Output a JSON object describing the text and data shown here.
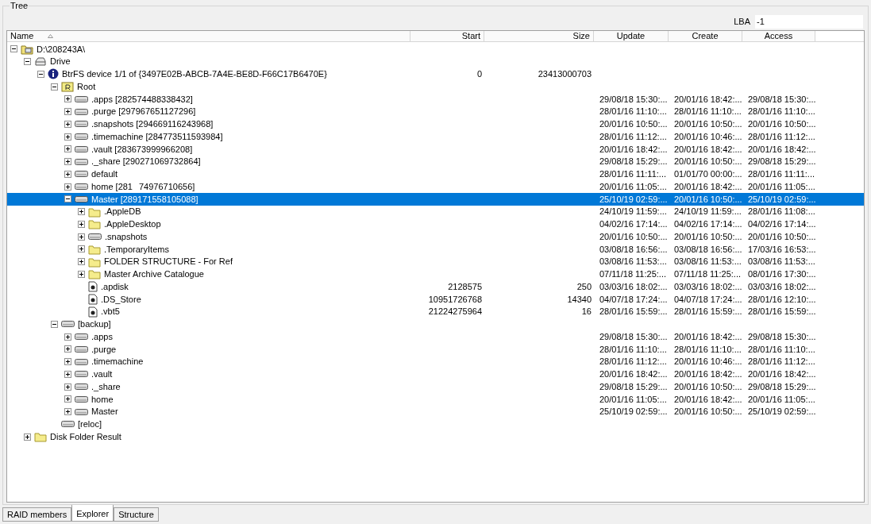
{
  "group_title": "Tree",
  "lba": {
    "label": "LBA",
    "value": "-1"
  },
  "columns": [
    {
      "label": "Name",
      "sorted": true
    },
    {
      "label": "Start",
      "sorted": false
    },
    {
      "label": "Size",
      "sorted": false
    },
    {
      "label": "Update",
      "sorted": false
    },
    {
      "label": "Create",
      "sorted": false
    },
    {
      "label": "Access",
      "sorted": false
    }
  ],
  "tree": [
    {
      "name": "D:\\208243A\\",
      "kind": "computer",
      "expanded": true,
      "selected": false,
      "children": [
        {
          "name": "Drive",
          "kind": "drive",
          "expanded": true,
          "selected": false,
          "children": [
            {
              "name": "BtrFS device 1/1 of {3497E02B-ABCB-7A4E-BE8D-F66C17B6470E}",
              "kind": "info",
              "expanded": true,
              "selected": false,
              "start": "0",
              "size": "23413000703",
              "children": [
                {
                  "name": "Root",
                  "kind": "root",
                  "expanded": true,
                  "selected": false,
                  "children": [
                    {
                      "name": ".apps [282574488338432]",
                      "kind": "disk",
                      "expanded": false,
                      "selected": false,
                      "update": "29/08/18 15:30:...",
                      "create": "20/01/16 18:42:...",
                      "access": "29/08/18 15:30:..."
                    },
                    {
                      "name": ".purge [297967651127296]",
                      "kind": "disk",
                      "expanded": false,
                      "selected": false,
                      "update": "28/01/16 11:10:...",
                      "create": "28/01/16 11:10:...",
                      "access": "28/01/16 11:10:..."
                    },
                    {
                      "name": ".snapshots [294669116243968]",
                      "kind": "disk",
                      "expanded": false,
                      "selected": false,
                      "update": "20/01/16 10:50:...",
                      "create": "20/01/16 10:50:...",
                      "access": "20/01/16 10:50:..."
                    },
                    {
                      "name": ".timemachine [284773511593984]",
                      "kind": "disk",
                      "expanded": false,
                      "selected": false,
                      "update": "28/01/16 11:12:...",
                      "create": "20/01/16 10:46:...",
                      "access": "28/01/16 11:12:..."
                    },
                    {
                      "name": ".vault [283673999966208]",
                      "kind": "disk",
                      "expanded": false,
                      "selected": false,
                      "update": "20/01/16 18:42:...",
                      "create": "20/01/16 18:42:...",
                      "access": "20/01/16 18:42:..."
                    },
                    {
                      "name": "._share [290271069732864]",
                      "kind": "disk",
                      "expanded": false,
                      "selected": false,
                      "update": "29/08/18 15:29:...",
                      "create": "20/01/16 10:50:...",
                      "access": "29/08/18 15:29:..."
                    },
                    {
                      "name": "default",
                      "kind": "disk",
                      "expanded": false,
                      "selected": false,
                      "update": "28/01/16 11:11:...",
                      "create": "01/01/70 00:00:...",
                      "access": "28/01/16 11:11:..."
                    },
                    {
                      "name": "home [281",
                      "name_tail": "74976710656]",
                      "kind": "disk",
                      "expanded": false,
                      "selected": false,
                      "update": "20/01/16 11:05:...",
                      "create": "20/01/16 18:42:...",
                      "access": "20/01/16 11:05:..."
                    },
                    {
                      "name": "Master [289171558105088]",
                      "kind": "disk",
                      "expanded": true,
                      "selected": true,
                      "update": "25/10/19 02:59:...",
                      "create": "20/01/16 10:50:...",
                      "access": "25/10/19 02:59:...",
                      "children": [
                        {
                          "name": ".AppleDB",
                          "kind": "folder",
                          "expanded": false,
                          "selected": false,
                          "update": "24/10/19 11:59:...",
                          "create": "24/10/19 11:59:...",
                          "access": "28/01/16 11:08:..."
                        },
                        {
                          "name": ".AppleDesktop",
                          "kind": "folder",
                          "expanded": false,
                          "selected": false,
                          "update": "04/02/16 17:14:...",
                          "create": "04/02/16 17:14:...",
                          "access": "04/02/16 17:14:..."
                        },
                        {
                          "name": ".snapshots",
                          "kind": "disk",
                          "expanded": false,
                          "selected": false,
                          "update": "20/01/16 10:50:...",
                          "create": "20/01/16 10:50:...",
                          "access": "20/01/16 10:50:..."
                        },
                        {
                          "name": ".TemporaryItems",
                          "kind": "folder",
                          "expanded": false,
                          "selected": false,
                          "update": "03/08/18 16:56:...",
                          "create": "03/08/18 16:56:...",
                          "access": "17/03/16 16:53:..."
                        },
                        {
                          "name": "FOLDER STRUCTURE - For Ref",
                          "kind": "folder",
                          "expanded": false,
                          "selected": false,
                          "update": "03/08/16 11:53:...",
                          "create": "03/08/16 11:53:...",
                          "access": "03/08/16 11:53:..."
                        },
                        {
                          "name": "Master Archive Catalogue",
                          "kind": "folder",
                          "expanded": false,
                          "selected": false,
                          "update": "07/11/18 11:25:...",
                          "create": "07/11/18 11:25:...",
                          "access": "08/01/16 17:30:..."
                        },
                        {
                          "name": ".apdisk",
                          "kind": "file",
                          "selected": false,
                          "start": "2128575",
                          "size": "250",
                          "update": "03/03/16 18:02:...",
                          "create": "03/03/16 18:02:...",
                          "access": "03/03/16 18:02:..."
                        },
                        {
                          "name": ".DS_Store",
                          "kind": "file",
                          "selected": false,
                          "start": "10951726768",
                          "size": "14340",
                          "update": "04/07/18 17:24:...",
                          "create": "04/07/18 17:24:...",
                          "access": "28/01/16 12:10:..."
                        },
                        {
                          "name": ".vbt5",
                          "kind": "file",
                          "selected": false,
                          "start": "21224275964",
                          "size": "16",
                          "update": "28/01/16 15:59:...",
                          "create": "28/01/16 15:59:...",
                          "access": "28/01/16 15:59:..."
                        }
                      ]
                    }
                  ]
                },
                {
                  "name": "[backup]",
                  "kind": "disk",
                  "expanded": true,
                  "selected": false,
                  "children": [
                    {
                      "name": ".apps",
                      "kind": "disk",
                      "expanded": false,
                      "selected": false,
                      "update": "29/08/18 15:30:...",
                      "create": "20/01/16 18:42:...",
                      "access": "29/08/18 15:30:..."
                    },
                    {
                      "name": ".purge",
                      "kind": "disk",
                      "expanded": false,
                      "selected": false,
                      "update": "28/01/16 11:10:...",
                      "create": "28/01/16 11:10:...",
                      "access": "28/01/16 11:10:..."
                    },
                    {
                      "name": ".timemachine",
                      "kind": "disk",
                      "expanded": false,
                      "selected": false,
                      "update": "28/01/16 11:12:...",
                      "create": "20/01/16 10:46:...",
                      "access": "28/01/16 11:12:..."
                    },
                    {
                      "name": ".vault",
                      "kind": "disk",
                      "expanded": false,
                      "selected": false,
                      "update": "20/01/16 18:42:...",
                      "create": "20/01/16 18:42:...",
                      "access": "20/01/16 18:42:..."
                    },
                    {
                      "name": "._share",
                      "kind": "disk",
                      "expanded": false,
                      "selected": false,
                      "update": "29/08/18 15:29:...",
                      "create": "20/01/16 10:50:...",
                      "access": "29/08/18 15:29:..."
                    },
                    {
                      "name": "home",
                      "kind": "disk",
                      "expanded": false,
                      "selected": false,
                      "update": "20/01/16 11:05:...",
                      "create": "20/01/16 18:42:...",
                      "access": "20/01/16 11:05:..."
                    },
                    {
                      "name": "Master",
                      "kind": "disk",
                      "expanded": false,
                      "selected": false,
                      "update": "25/10/19 02:59:...",
                      "create": "20/01/16 10:50:...",
                      "access": "25/10/19 02:59:..."
                    }
                  ]
                },
                {
                  "name": "[reloc]",
                  "kind": "disk",
                  "selected": false
                }
              ]
            }
          ]
        },
        {
          "name": "Disk Folder Result",
          "kind": "folder",
          "expanded": false,
          "selected": false
        }
      ]
    }
  ],
  "tabs": [
    {
      "label": "RAID members",
      "selected": false
    },
    {
      "label": "Explorer",
      "selected": true
    },
    {
      "label": "Structure",
      "selected": false
    }
  ]
}
